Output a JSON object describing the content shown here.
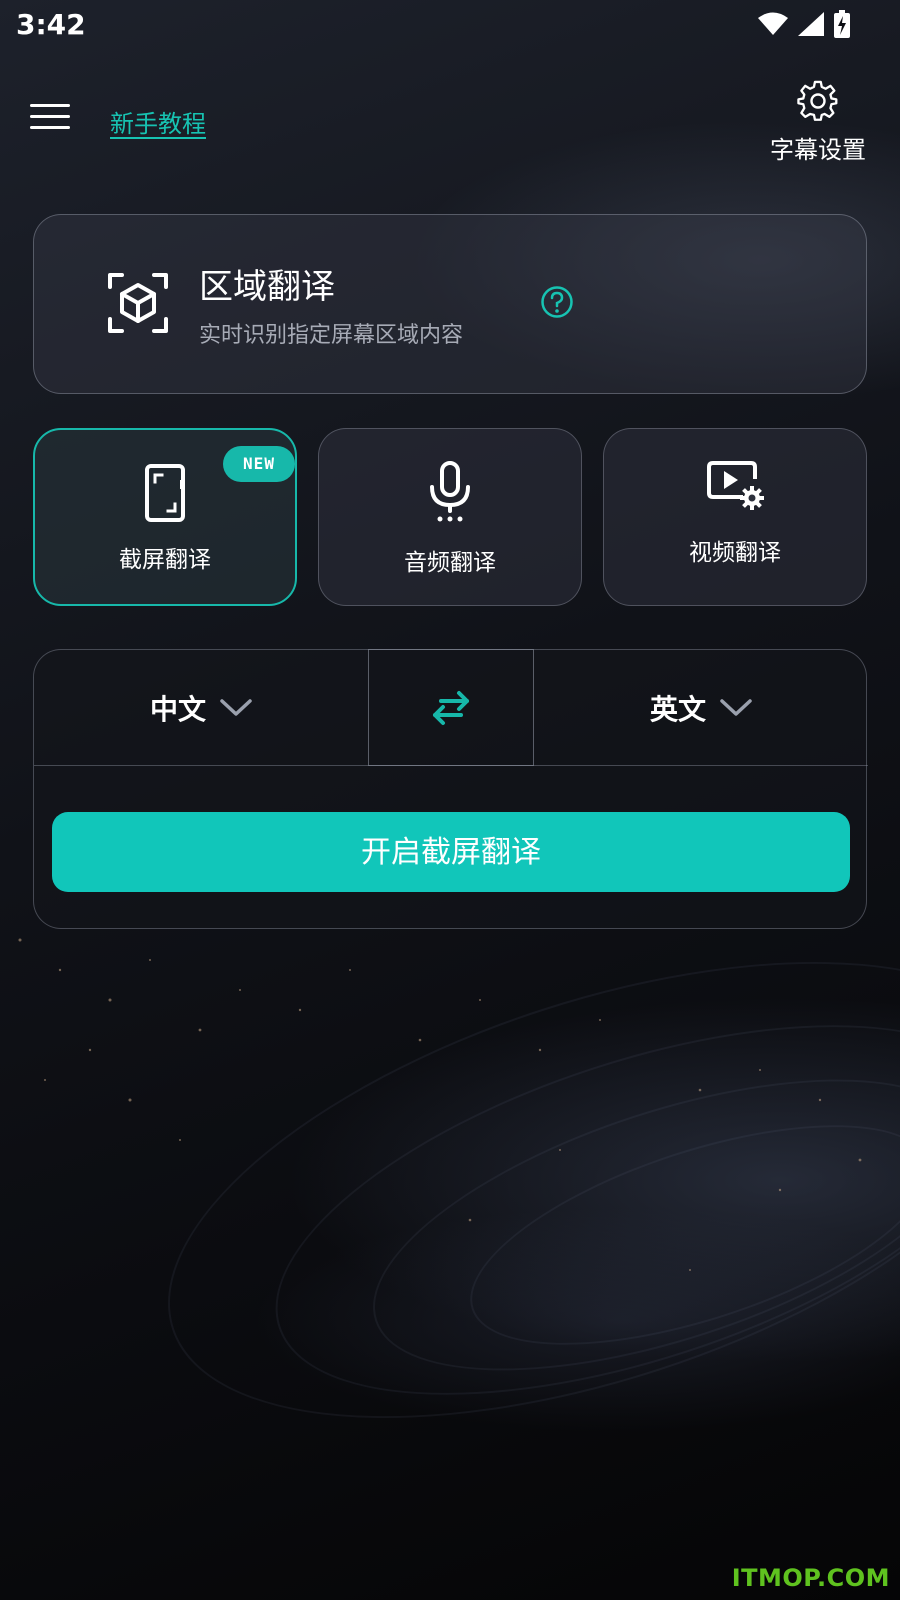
{
  "status_bar": {
    "time": "3:42",
    "icons": [
      "wifi-icon",
      "signal-icon",
      "battery-charging-icon"
    ]
  },
  "header": {
    "menu_icon": "hamburger-menu-icon",
    "tutorial_link": "新手教程",
    "settings_icon": "gear-icon",
    "settings_label": "字幕设置"
  },
  "region_card": {
    "icon": "scan-cube-icon",
    "title": "区域翻译",
    "description": "实时识别指定屏幕区域内容",
    "help_icon": "question-circle-icon"
  },
  "modes": [
    {
      "label": "截屏翻译",
      "icon": "phone-screenshot-icon",
      "badge": "NEW",
      "active": true
    },
    {
      "label": "音频翻译",
      "icon": "microphone-icon",
      "active": false
    },
    {
      "label": "视频翻译",
      "icon": "video-settings-icon",
      "active": false
    }
  ],
  "language": {
    "source": "中文",
    "target": "英文",
    "swap_icon": "swap-arrows-icon",
    "dropdown_icon": "chevron-down-icon"
  },
  "start_button": "开启截屏翻译",
  "watermark": "ITMOP.COM",
  "colors": {
    "accent": "#17b8aa",
    "button": "#11c6ba",
    "watermark": "#5fc21f"
  }
}
